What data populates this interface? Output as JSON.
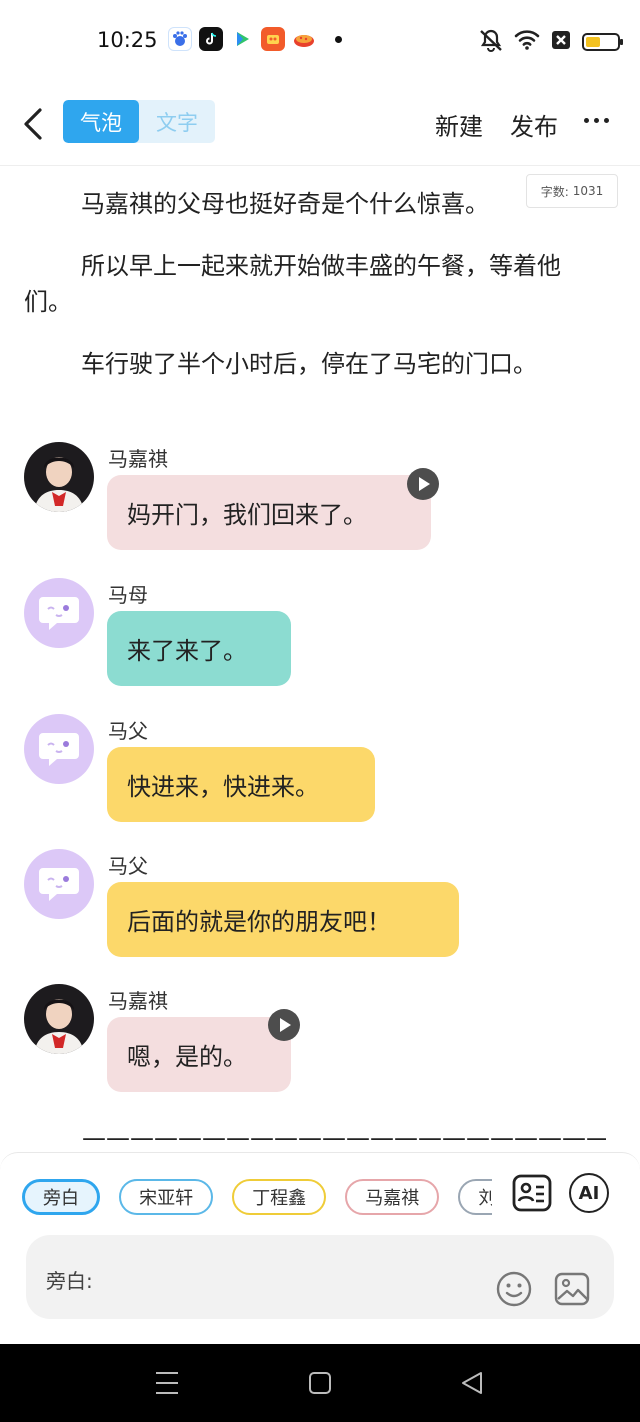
{
  "status_bar": {
    "time": "10:25"
  },
  "header": {
    "seg_bubble": "气泡",
    "seg_text": "文字",
    "new_label": "新建",
    "publish_label": "发布"
  },
  "word_count": {
    "label": "字数:",
    "value": "1031"
  },
  "narration": [
    "马嘉祺的父母也挺好奇是个什么惊喜。",
    "所以早上一起来就开始做丰盛的午餐，等着他们。",
    "车行驶了半个小时后，停在了马宅的门口。"
  ],
  "messages": [
    {
      "sender": "马嘉祺",
      "text": "妈开门，我们回来了。",
      "bubble_color": "#f4dedf",
      "avatar": "photo-avatar",
      "has_voice": true
    },
    {
      "sender": "马母",
      "text": "来了来了。",
      "bubble_color": "#8cdcd1",
      "avatar": "ghost-avatar",
      "has_voice": false
    },
    {
      "sender": "马父",
      "text": "快进来，快进来。",
      "bubble_color": "#fcd86a",
      "avatar": "ghost-avatar",
      "has_voice": false
    },
    {
      "sender": "马父",
      "text": "后面的就是你的朋友吧！",
      "bubble_color": "#fcd86a",
      "avatar": "ghost-avatar",
      "has_voice": false
    },
    {
      "sender": "马嘉祺",
      "text": "嗯，是的。",
      "bubble_color": "#f4dedf",
      "avatar": "photo-avatar",
      "has_voice": true
    }
  ],
  "divider_text": "————————————————————————",
  "role_chips": [
    {
      "label": "旁白",
      "border": "#2fa6ee",
      "bg": "#e6f4fd",
      "selected": true
    },
    {
      "label": "宋亚轩",
      "border": "#5bb8e8",
      "bg": "#ffffff",
      "selected": false
    },
    {
      "label": "丁程鑫",
      "border": "#efcc38",
      "bg": "#ffffff",
      "selected": false
    },
    {
      "label": "马嘉祺",
      "border": "#e6a6aa",
      "bg": "#ffffff",
      "selected": false
    },
    {
      "label": "刘耀文",
      "border": "#9aa6b3",
      "bg": "#ffffff",
      "selected": false
    }
  ],
  "tools": {
    "ai_label": "AI"
  },
  "input": {
    "label": "旁白:"
  },
  "colors": {
    "accent": "#2fa6ee",
    "ghost_avatar": "#dcc8f7"
  }
}
